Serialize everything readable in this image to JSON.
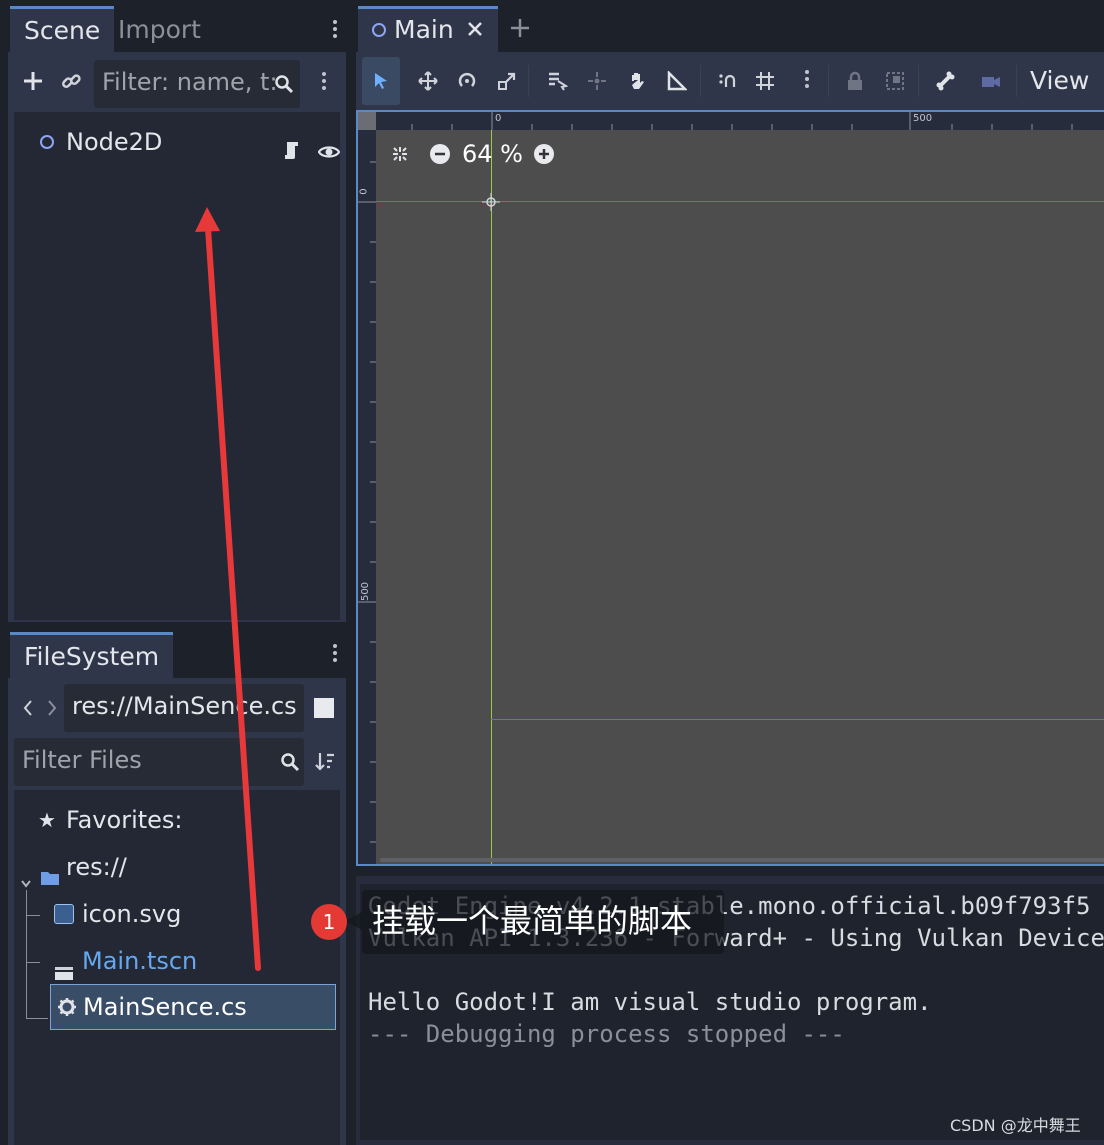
{
  "scene_panel": {
    "tabs": [
      {
        "label": "Scene"
      },
      {
        "label": "Import"
      }
    ],
    "filter_placeholder": "Filter: name, t:",
    "tree": [
      {
        "label": "Node2D"
      }
    ]
  },
  "filesystem_panel": {
    "tab_label": "FileSystem",
    "path": "res://MainSence.cs",
    "filter_placeholder": "Filter Files",
    "tree": {
      "favorites": "Favorites:",
      "root": "res://",
      "files": [
        {
          "label": "icon.svg"
        },
        {
          "label": "Main.tscn"
        },
        {
          "label": "MainSence.cs"
        }
      ]
    }
  },
  "editor": {
    "tab_label": "Main",
    "view_label": "View",
    "zoom": "64 %",
    "ruler": {
      "h_marks": [
        "0",
        "500"
      ],
      "v_marks": [
        "0",
        "500"
      ]
    }
  },
  "output": {
    "lines": [
      "Godot Engine v4.2.1.stable.mono.official.b09f793f5",
      "Vulkan API 1.3.236 - Forward+ - Using Vulkan Device",
      "",
      "Hello Godot!I am visual studio program.",
      "--- Debugging process stopped ---"
    ]
  },
  "annotation": {
    "number": "1",
    "text": "挂载一个最简单的脚本"
  },
  "watermark": "CSDN @龙中舞王",
  "colors": {
    "accent": "#5a89c7",
    "arrow": "#e8393a",
    "badge": "#e53935",
    "selected_row": "#3a4d66",
    "scene_file": "#66a8f0",
    "viewport": "#4d4d4d"
  }
}
